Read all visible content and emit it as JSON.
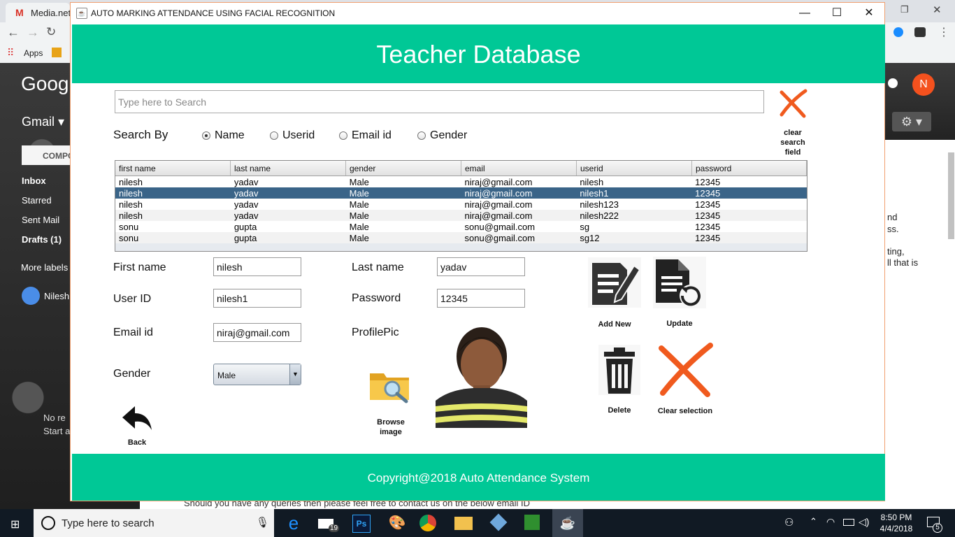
{
  "browser": {
    "tab_title": "Media.net",
    "bookmark_apps": "Apps"
  },
  "gmail": {
    "logo": "Goog",
    "label": "Gmail ▾",
    "compose": "COMPO",
    "nav": [
      "Inbox",
      "Starred",
      "Sent Mail",
      "Drafts (1)",
      "More labels"
    ],
    "user": "Nilesh",
    "no_recent": "No re",
    "start": "Start a",
    "avatar_initial": "N",
    "right_snippets": [
      "nd",
      "ss.",
      "ting,",
      "ll that is"
    ],
    "bottom_text": "Should you have any queries then please feel free to contact us on the below email ID"
  },
  "window": {
    "title": "AUTO MARKING ATTENDANCE USING FACIAL RECOGNITION",
    "minimize": "—",
    "maximize": "☐",
    "close": "✕"
  },
  "header": {
    "title": "Teacher Database"
  },
  "search": {
    "placeholder": "Type here to Search",
    "clear_label": "clear search field",
    "search_by_label": "Search By",
    "options": [
      "Name",
      "Userid",
      "Email id",
      "Gender"
    ],
    "selected": "Name"
  },
  "table": {
    "columns": [
      "first name",
      "last name",
      "gender",
      "email",
      "userid",
      "password"
    ],
    "rows": [
      [
        "nilesh",
        "yadav",
        "Male",
        "niraj@gmail.com",
        "nilesh",
        "12345"
      ],
      [
        "nilesh",
        "yadav",
        "Male",
        "niraj@gmail.com",
        "nilesh1",
        "12345"
      ],
      [
        "nilesh",
        "yadav",
        "Male",
        "niraj@gmail.com",
        "nilesh123",
        "12345"
      ],
      [
        "nilesh",
        "yadav",
        "Male",
        "niraj@gmail.com",
        "nilesh222",
        "12345"
      ],
      [
        "sonu",
        "gupta",
        "Male",
        "sonu@gmail.com",
        "sg",
        "12345"
      ],
      [
        "sonu",
        "gupta",
        "Male",
        "sonu@gmail.com",
        "sg12",
        "12345"
      ]
    ],
    "selected_row": 1
  },
  "form": {
    "first_name_label": "First name",
    "first_name": "nilesh",
    "last_name_label": "Last name",
    "last_name": "yadav",
    "userid_label": "User ID",
    "userid": "nilesh1",
    "password_label": "Password",
    "password": "12345",
    "email_label": "Email id",
    "email": "niraj@gmail.com",
    "profile_label": "ProfilePic",
    "gender_label": "Gender",
    "gender": "Male"
  },
  "buttons": {
    "back": "Back",
    "browse": "Browse image",
    "add_new": "Add New",
    "update": "Update",
    "delete": "Delete",
    "clear_selection": "Clear selection"
  },
  "footer": {
    "text": "Copyright@2018 Auto Attendance System"
  },
  "taskbar": {
    "search_placeholder": "Type here to search",
    "mail_badge": "19",
    "time": "8:50 PM",
    "date": "4/4/2018",
    "notification_count": "5"
  },
  "colors": {
    "accent": "#00c896",
    "selected_row": "#3a6488",
    "cross": "#f05a1e"
  }
}
